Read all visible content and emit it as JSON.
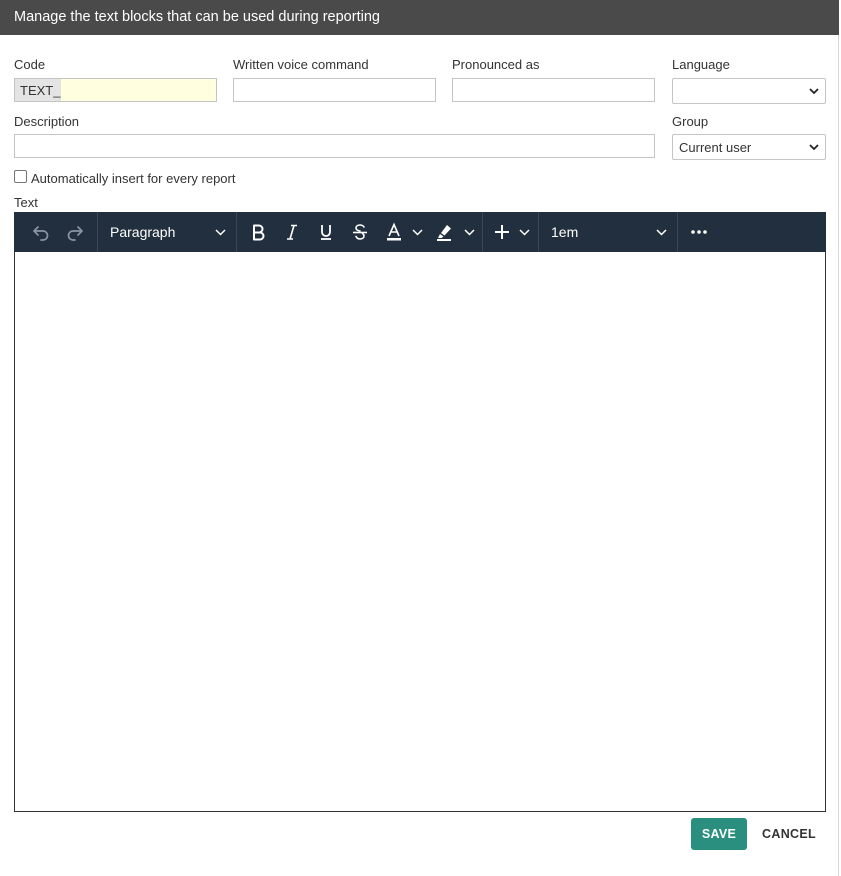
{
  "dialog": {
    "title": "Manage the text blocks that can be used during reporting"
  },
  "form": {
    "code": {
      "label": "Code",
      "prefix": "TEXT_",
      "value": ""
    },
    "voice_command": {
      "label": "Written voice command",
      "value": ""
    },
    "pronounced_as": {
      "label": "Pronounced as",
      "value": ""
    },
    "language": {
      "label": "Language",
      "selected": ""
    },
    "description": {
      "label": "Description",
      "value": ""
    },
    "group": {
      "label": "Group",
      "selected": "Current user"
    },
    "auto_insert": {
      "label": "Automatically insert for every report",
      "checked": false
    },
    "text": {
      "label": "Text"
    }
  },
  "editor_toolbar": {
    "block_format": "Paragraph",
    "font_size": "1em",
    "icons": [
      "undo-icon",
      "redo-icon",
      "bold-icon",
      "italic-icon",
      "underline-icon",
      "strikethrough-icon",
      "text-color-icon",
      "highlight-icon",
      "insert-plus-icon",
      "more-icon"
    ]
  },
  "actions": {
    "save_label": "SAVE",
    "cancel_label": "CANCEL"
  },
  "colors": {
    "title_bar": "#4a4a4a",
    "toolbar": "#222f3e",
    "save_button": "#2a8f7e",
    "code_input_bg": "#ffffe0"
  }
}
